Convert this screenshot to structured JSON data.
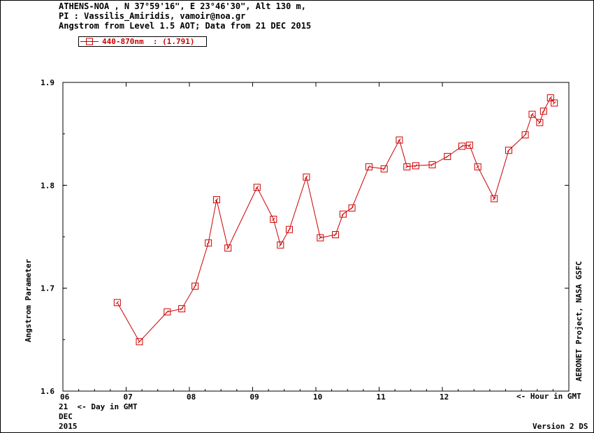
{
  "header": {
    "line1": "ATHENS-NOA , N 37°59'16\", E 23°46'30\", Alt 130 m,",
    "line2": "PI : Vassilis_Amiridis, vamoir@noa.gr",
    "line3": "Angstrom from Level 1.5 AOT; Data from 21 DEC 2015"
  },
  "legend": {
    "label": "440-870nm  : (1.791)"
  },
  "side_label": "AERONET Project, NASA GSFC",
  "footer": {
    "day_hint": "21  <- Day in GMT",
    "month": "DEC",
    "year": "2015",
    "hour_hint": "<- Hour in GMT",
    "version": "Version 2 DS"
  },
  "colors": {
    "series": "#cc0000",
    "axis": "#000000",
    "background": "#ffffff"
  },
  "chart_data": {
    "type": "line",
    "ylabel": "Angstrom Parameter",
    "xlim": [
      6.0,
      14.0
    ],
    "ylim": [
      1.6,
      1.9
    ],
    "x_ticks": [
      {
        "value": 6,
        "label": "06"
      },
      {
        "value": 7,
        "label": "07"
      },
      {
        "value": 8,
        "label": "08"
      },
      {
        "value": 9,
        "label": "09"
      },
      {
        "value": 10,
        "label": "10"
      },
      {
        "value": 11,
        "label": "11"
      },
      {
        "value": 12,
        "label": "12"
      }
    ],
    "y_ticks": [
      {
        "value": 1.6,
        "label": "1.6"
      },
      {
        "value": 1.7,
        "label": "1.7"
      },
      {
        "value": 1.8,
        "label": "1.8"
      },
      {
        "value": 1.9,
        "label": "1.9"
      }
    ],
    "grid": false,
    "series": [
      {
        "name": "440-870nm",
        "x": [
          6.86,
          7.21,
          7.65,
          7.88,
          8.09,
          8.3,
          8.43,
          8.61,
          9.07,
          9.33,
          9.44,
          9.58,
          9.85,
          10.07,
          10.31,
          10.43,
          10.57,
          10.84,
          11.08,
          11.32,
          11.44,
          11.58,
          11.84,
          12.08,
          12.31,
          12.43,
          12.56,
          12.82,
          13.05,
          13.31,
          13.42,
          13.54,
          13.6,
          13.71,
          13.77
        ],
        "y": [
          1.686,
          1.648,
          1.677,
          1.68,
          1.702,
          1.744,
          1.786,
          1.739,
          1.798,
          1.767,
          1.742,
          1.757,
          1.808,
          1.749,
          1.752,
          1.772,
          1.778,
          1.818,
          1.816,
          1.844,
          1.818,
          1.819,
          1.82,
          1.828,
          1.838,
          1.839,
          1.818,
          1.787,
          1.834,
          1.849,
          1.869,
          1.861,
          1.872,
          1.885,
          1.88
        ]
      }
    ]
  }
}
